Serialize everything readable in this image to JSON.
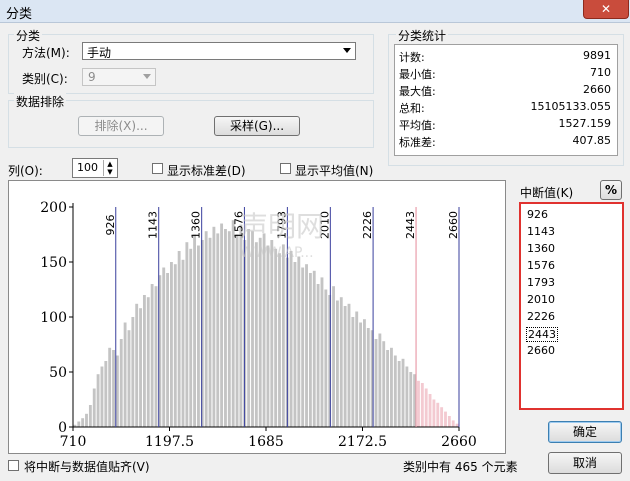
{
  "window": {
    "title": "分类",
    "close": "✕"
  },
  "classification": {
    "group_label": "分类",
    "method_label": "方法(M):",
    "method_value": "手动",
    "classes_label": "类别(C):",
    "classes_value": "9"
  },
  "exclusion": {
    "group_label": "数据排除",
    "exclude_button": "排除(X)...",
    "sample_button": "采样(G)..."
  },
  "stats": {
    "group_label": "分类统计",
    "rows": [
      {
        "label": "计数:",
        "value": "9891"
      },
      {
        "label": "最小值:",
        "value": "710"
      },
      {
        "label": "最大值:",
        "value": "2660"
      },
      {
        "label": "总和:",
        "value": "15105133.055"
      },
      {
        "label": "平均值:",
        "value": "1527.159"
      },
      {
        "label": "标准差:",
        "value": "407.85"
      }
    ]
  },
  "options": {
    "columns_label": "列(O):",
    "columns_value": "100",
    "show_std_label": "显示标准差(D)",
    "show_mean_label": "显示平均值(N)"
  },
  "breaks": {
    "label": "中断值(K)",
    "percent_button": "%",
    "values": [
      "926",
      "1143",
      "1360",
      "1576",
      "1793",
      "2010",
      "2226",
      "2443",
      "2660"
    ],
    "selected_index": 7
  },
  "buttons": {
    "ok": "确定",
    "cancel": "取消"
  },
  "footer": {
    "snap_label": "将中断与数据值贴齐(V)",
    "count_prefix": "类别中有",
    "count_value": "465",
    "count_suffix": "个元素"
  },
  "watermark": {
    "line1": "声明网",
    "line2": "WWW.AP..."
  },
  "chart_data": {
    "type": "bar",
    "x_range": [
      710,
      2660
    ],
    "ylim": [
      0,
      200
    ],
    "x_ticks": [
      "710",
      "1197.5",
      "1685",
      "2172.5",
      "2660"
    ],
    "y_ticks": [
      "0",
      "50",
      "100",
      "150",
      "200"
    ],
    "bins": 100,
    "bar_color": "#c4c4c4",
    "break_color": "#3a3f9e",
    "selected_break_color": "#e58a9a",
    "selected_break_band": {
      "from": 2443,
      "to": 2660,
      "color": "#e58a9a"
    },
    "values": [
      2,
      5,
      8,
      12,
      20,
      35,
      48,
      55,
      60,
      72,
      70,
      65,
      80,
      95,
      88,
      100,
      112,
      108,
      120,
      118,
      130,
      128,
      138,
      145,
      140,
      150,
      148,
      160,
      152,
      168,
      162,
      175,
      165,
      170,
      178,
      172,
      182,
      176,
      185,
      180,
      178,
      188,
      175,
      184,
      170,
      180,
      178,
      168,
      172,
      176,
      165,
      170,
      162,
      158,
      166,
      154,
      160,
      150,
      155,
      145,
      148,
      140,
      142,
      130,
      136,
      125,
      120,
      128,
      115,
      118,
      110,
      112,
      100,
      105,
      95,
      98,
      90,
      88,
      80,
      85,
      78,
      70,
      72,
      65,
      60,
      62,
      55,
      50,
      48,
      42,
      40,
      35,
      30,
      25,
      22,
      18,
      14,
      10,
      6,
      3
    ],
    "breaks": [
      926,
      1143,
      1360,
      1576,
      1793,
      2010,
      2226,
      2443,
      2660
    ],
    "selected_break": 2443
  }
}
